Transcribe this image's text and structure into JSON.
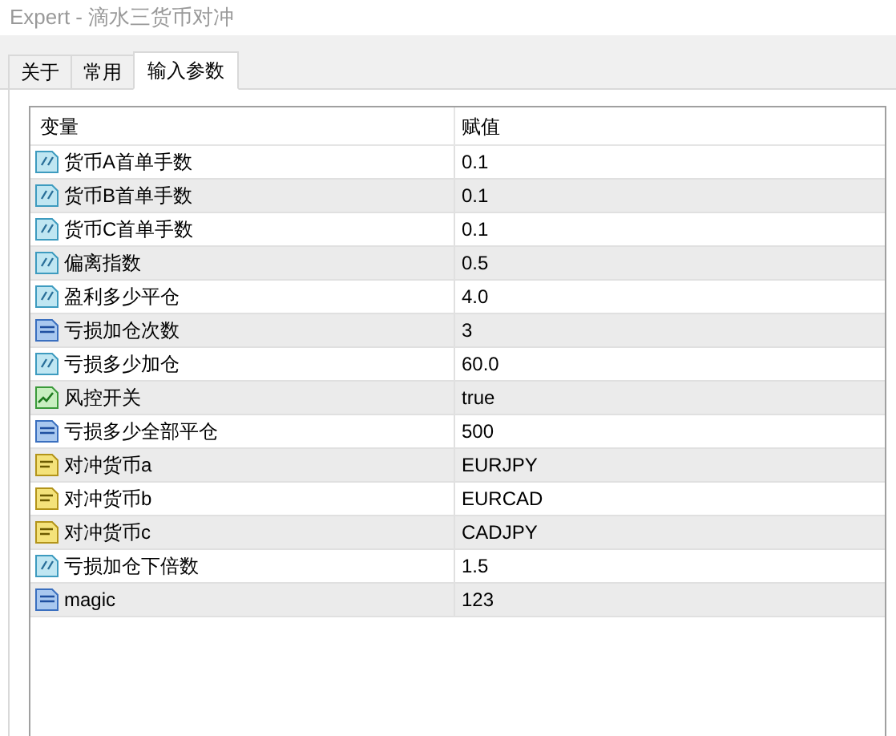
{
  "window": {
    "title": "Expert - 滴水三货币对冲"
  },
  "tabs": [
    {
      "label": "关于",
      "selected": false
    },
    {
      "label": "常用",
      "selected": false
    },
    {
      "label": "输入参数",
      "selected": true
    }
  ],
  "table": {
    "columns": [
      "变量",
      "赋值"
    ],
    "rows": [
      {
        "kind": "double",
        "name": "货币A首单手数",
        "value": "0.1"
      },
      {
        "kind": "double",
        "name": "货币B首单手数",
        "value": "0.1"
      },
      {
        "kind": "double",
        "name": "货币C首单手数",
        "value": "0.1"
      },
      {
        "kind": "double",
        "name": "偏离指数",
        "value": "0.5"
      },
      {
        "kind": "double",
        "name": "盈利多少平仓",
        "value": "4.0"
      },
      {
        "kind": "int",
        "name": "亏损加仓次数",
        "value": "3"
      },
      {
        "kind": "double",
        "name": "亏损多少加仓",
        "value": "60.0"
      },
      {
        "kind": "bool",
        "name": "风控开关",
        "value": "true"
      },
      {
        "kind": "int",
        "name": "亏损多少全部平仓",
        "value": "500"
      },
      {
        "kind": "string",
        "name": "对冲货币a",
        "value": "EURJPY"
      },
      {
        "kind": "string",
        "name": "对冲货币b",
        "value": "EURCAD"
      },
      {
        "kind": "string",
        "name": "对冲货币c",
        "value": "CADJPY"
      },
      {
        "kind": "double",
        "name": "亏损加仓下倍数",
        "value": "1.5"
      },
      {
        "kind": "int",
        "name": "magic",
        "value": "123"
      }
    ]
  }
}
